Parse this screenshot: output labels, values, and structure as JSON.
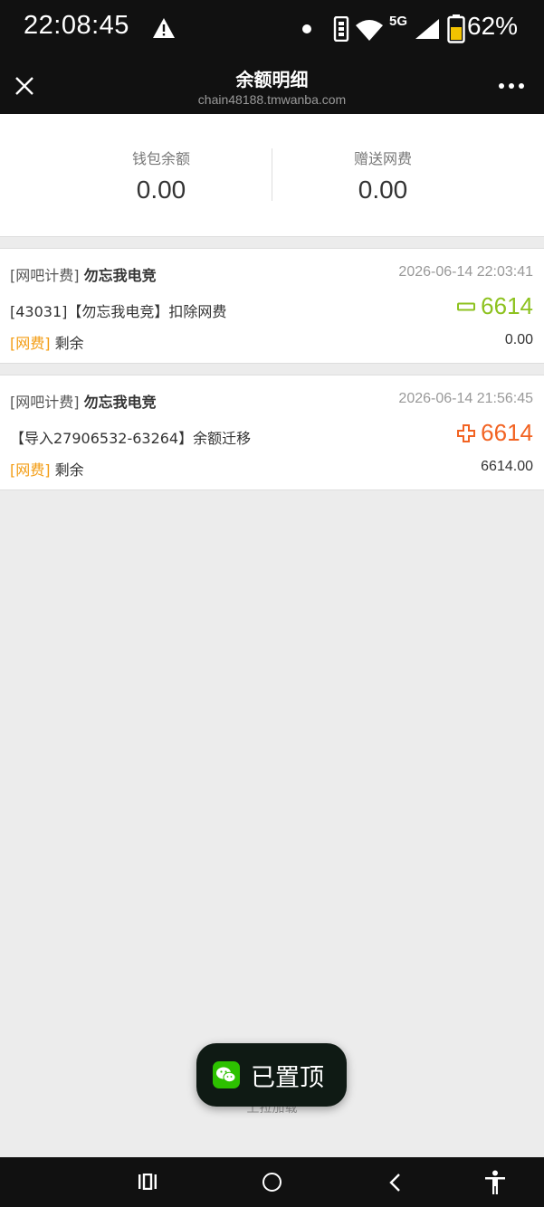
{
  "status_bar": {
    "time": "22:08:45",
    "network": "5G",
    "battery": "62%",
    "icons": [
      "warning-icon",
      "dot-icon",
      "vibrate-icon",
      "wifi-icon",
      "signal-icon",
      "battery-icon"
    ]
  },
  "header": {
    "title": "余额明细",
    "url": "chain48188.tmwanba.com",
    "close_icon": "close-icon",
    "more_icon": "more-icon"
  },
  "balance": {
    "wallet_label": "钱包余额",
    "wallet_value": "0.00",
    "bonus_label": "赠送网费",
    "bonus_value": "0.00"
  },
  "records": [
    {
      "category": "[网吧计费]",
      "merchant": "勿忘我电竞",
      "time": "2026-06-14 22:03:41",
      "description": "[43031]【勿忘我电竞】扣除网费",
      "sign": "minus",
      "amount": "6614",
      "tag": "[网费]",
      "remain_label": "剩余",
      "remain": "0.00"
    },
    {
      "category": "[网吧计费]",
      "merchant": "勿忘我电竞",
      "time": "2026-06-14 21:56:45",
      "description": "【导入27906532-63264】余额迁移",
      "sign": "plus",
      "amount": "6614",
      "tag": "[网费]",
      "remain_label": "剩余",
      "remain": "6614.00"
    }
  ],
  "colors": {
    "minus": "#8dc21f",
    "plus": "#f26322",
    "tag": "#f39c12"
  },
  "pull_hint": "上拉加载",
  "toast": {
    "icon": "wechat-icon",
    "text": "已置顶"
  },
  "nav_bar": {
    "icons": [
      "recent-apps-icon",
      "home-icon",
      "back-icon",
      "accessibility-icon"
    ]
  }
}
